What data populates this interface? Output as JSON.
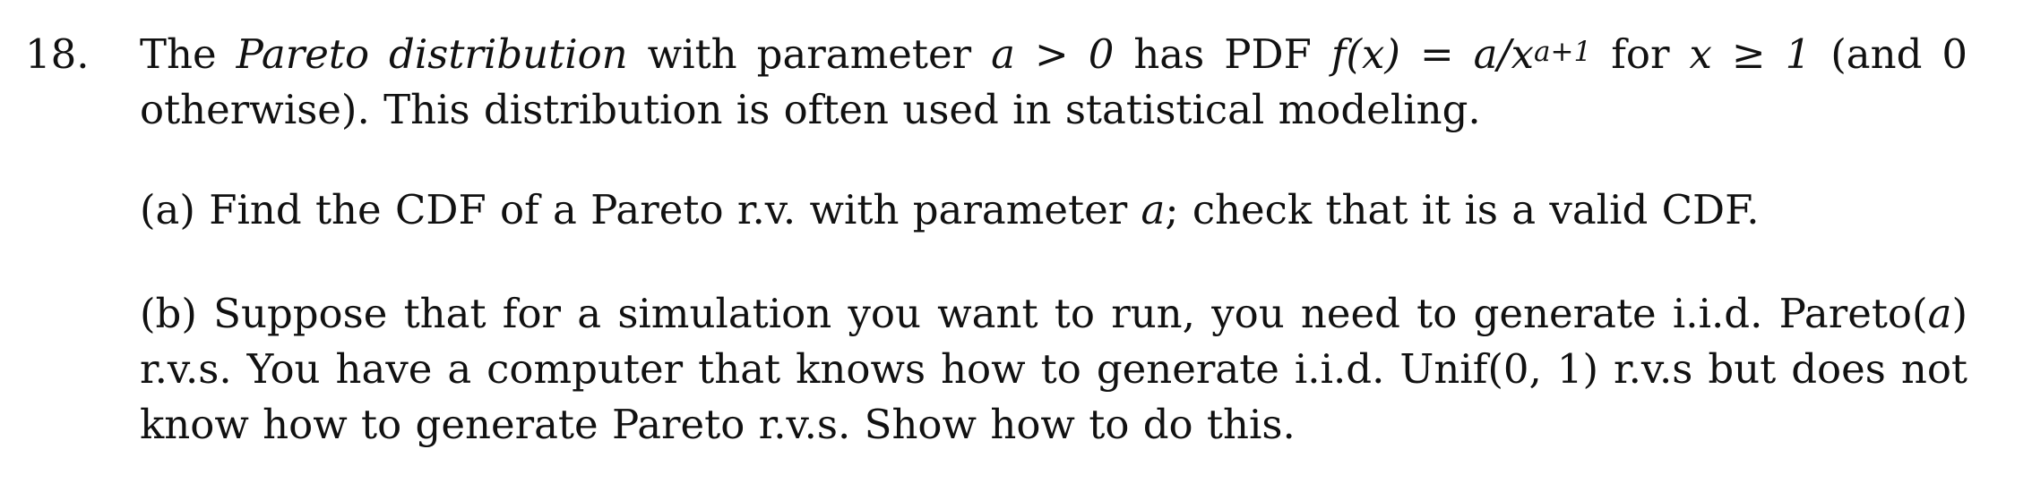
{
  "problem": {
    "number": "18.",
    "intro": {
      "t1": "The ",
      "term": "Pareto distribution",
      "t2": " with parameter ",
      "m1": "a > 0",
      "t3": " has PDF ",
      "m2": "f(x) = a/x",
      "m2_exp": "a+1",
      "t4": " for ",
      "m3": "x ≥ 1",
      "t5": " (and 0 otherwise). This distribution is often used in statistical modeling."
    },
    "part_a": {
      "t1": "(a) Find the CDF of a Pareto r.v. with parameter ",
      "m1": "a",
      "t2": "; check that it is a valid CDF."
    },
    "part_b": {
      "t1": "(b) Suppose that for a simulation you want to run, you need to generate i.i.d. Pareto(",
      "m1": "a",
      "t2": ") r.v.s. You have a computer that knows how to generate i.i.d. Unif(0, 1) r.v.s but does not know how to generate Pareto r.v.s. Show how to do this."
    }
  }
}
